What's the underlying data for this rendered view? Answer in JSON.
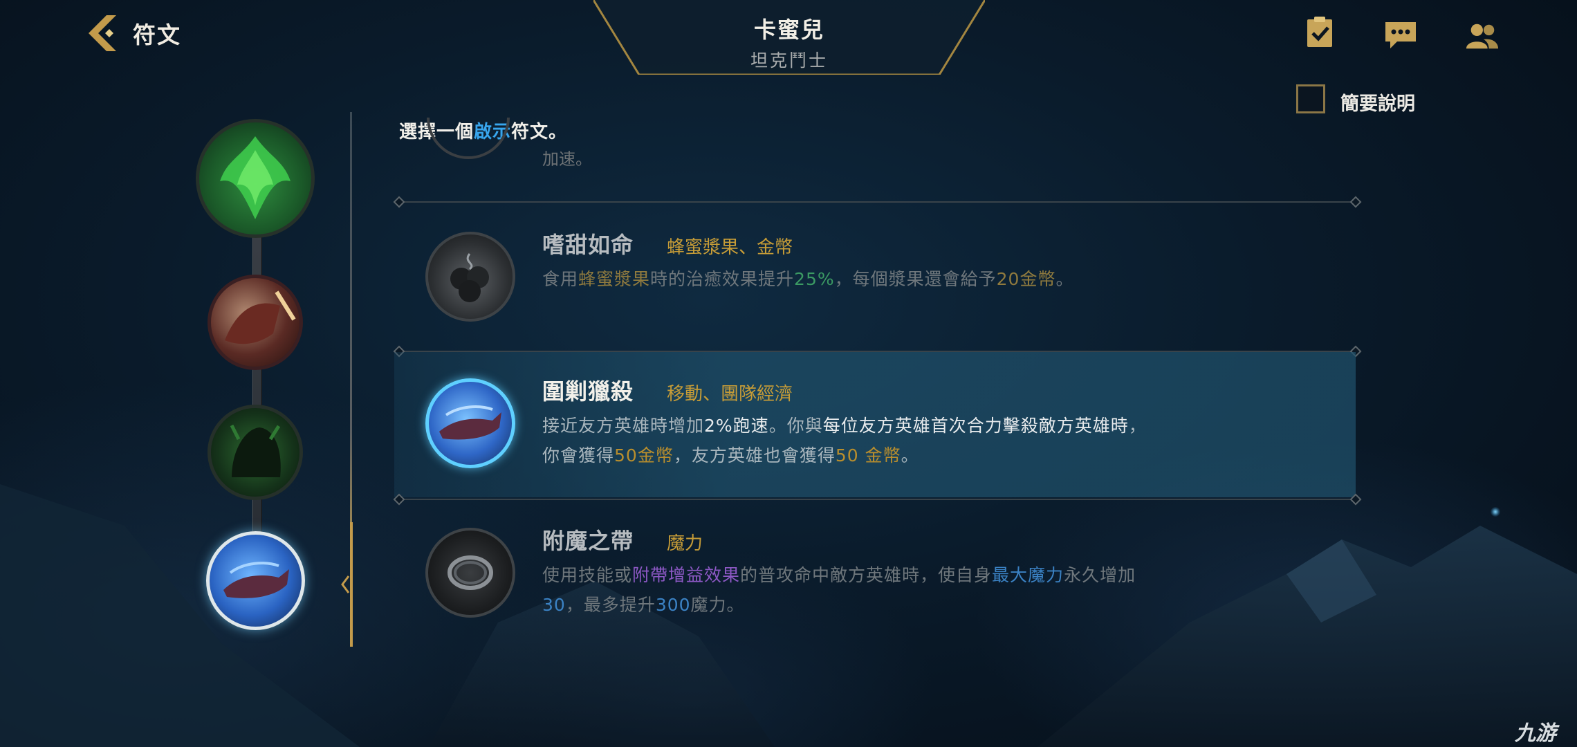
{
  "header": {
    "back_label": "符文",
    "champion_name": "卡蜜兒",
    "champion_role": "坦克鬥士",
    "icons": [
      "checklist-icon",
      "chat-icon",
      "friends-icon"
    ]
  },
  "brief_toggle": {
    "label": "簡要說明",
    "checked": false
  },
  "instruction": {
    "before": "選擇一個",
    "highlight": "啟示",
    "after": "符文。"
  },
  "previous_rune_partial_text": "加速。",
  "runes": [
    {
      "name": "嗜甜如命",
      "tags": "蜂蜜漿果、金幣",
      "selected": false,
      "desc": [
        {
          "t": "食用",
          "c": ""
        },
        {
          "t": "蜂蜜漿果",
          "c": "gold"
        },
        {
          "t": "時的治癒效果提升",
          "c": ""
        },
        {
          "t": "25%",
          "c": "green"
        },
        {
          "t": "，每個漿果還會給予",
          "c": ""
        },
        {
          "t": "20金幣",
          "c": "gold"
        },
        {
          "t": "。",
          "c": ""
        }
      ]
    },
    {
      "name": "圍剿獵殺",
      "tags": "移動、團隊經濟",
      "selected": true,
      "desc": [
        {
          "t": "接近友方英雄時增加",
          "c": ""
        },
        {
          "t": "2%跑速",
          "c": "white"
        },
        {
          "t": "。你與",
          "c": ""
        },
        {
          "t": "每位友方英雄首次合力擊殺敵方英雄時",
          "c": "white"
        },
        {
          "t": "，\n你會獲得",
          "c": ""
        },
        {
          "t": "50金幣",
          "c": "gold"
        },
        {
          "t": "，友方英雄也會獲得",
          "c": ""
        },
        {
          "t": "50 金幣",
          "c": "gold"
        },
        {
          "t": "。",
          "c": ""
        }
      ]
    },
    {
      "name": "附魔之帶",
      "tags": "魔力",
      "selected": false,
      "desc": [
        {
          "t": "使用技能或",
          "c": ""
        },
        {
          "t": "附帶增益效果",
          "c": "purple"
        },
        {
          "t": "的普攻命中敵方英雄時，使自身",
          "c": ""
        },
        {
          "t": "最大魔力",
          "c": "blue"
        },
        {
          "t": "永久增加\n",
          "c": ""
        },
        {
          "t": "30",
          "c": "blue"
        },
        {
          "t": "，最多提升",
          "c": ""
        },
        {
          "t": "300",
          "c": "blue"
        },
        {
          "t": "魔力。",
          "c": ""
        }
      ]
    }
  ],
  "path_nodes": [
    "keystone-rune",
    "first-slot-rune",
    "second-slot-rune",
    "third-slot-rune"
  ],
  "watermark": "九游",
  "colors": {
    "accent_gold": "#c39b4b",
    "highlight_blue": "#38a6ee"
  }
}
